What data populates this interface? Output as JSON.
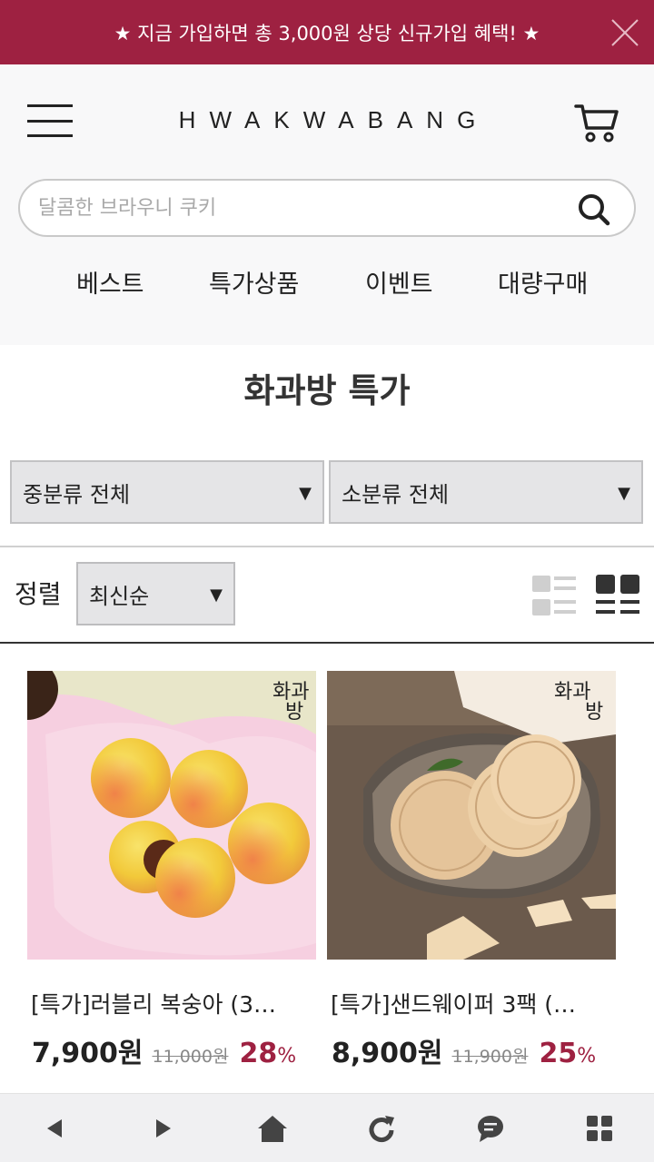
{
  "banner": {
    "text": "★ 지금 가입하면 총 3,000원 상당 신규가입 혜택! ★"
  },
  "header": {
    "logo": "HWAKWABANG"
  },
  "search": {
    "placeholder": "달콤한 브라우니 쿠키"
  },
  "nav": {
    "items": [
      "베스트",
      "특가상품",
      "이벤트",
      "대량구매"
    ]
  },
  "page_title": "화과방 특가",
  "filters": {
    "middle_category": "중분류 전체",
    "sub_category": "소분류 전체"
  },
  "sort": {
    "label": "정렬",
    "value": "최신순"
  },
  "products": [
    {
      "name": "[특가]러블리 복숭아 (3…",
      "price": "7,900원",
      "original_price": "11,000원",
      "discount": "28",
      "discount_unit": "%"
    },
    {
      "name": "[특가]샌드웨이퍼 3팩 (…",
      "price": "8,900원",
      "original_price": "11,900원",
      "discount": "25",
      "discount_unit": "%"
    }
  ],
  "colors": {
    "brand": "#9e2141",
    "header_bg": "#f8f8f9"
  },
  "icons": {
    "close": "close-icon",
    "menu": "hamburger-icon",
    "cart": "cart-icon",
    "search": "search-icon"
  }
}
